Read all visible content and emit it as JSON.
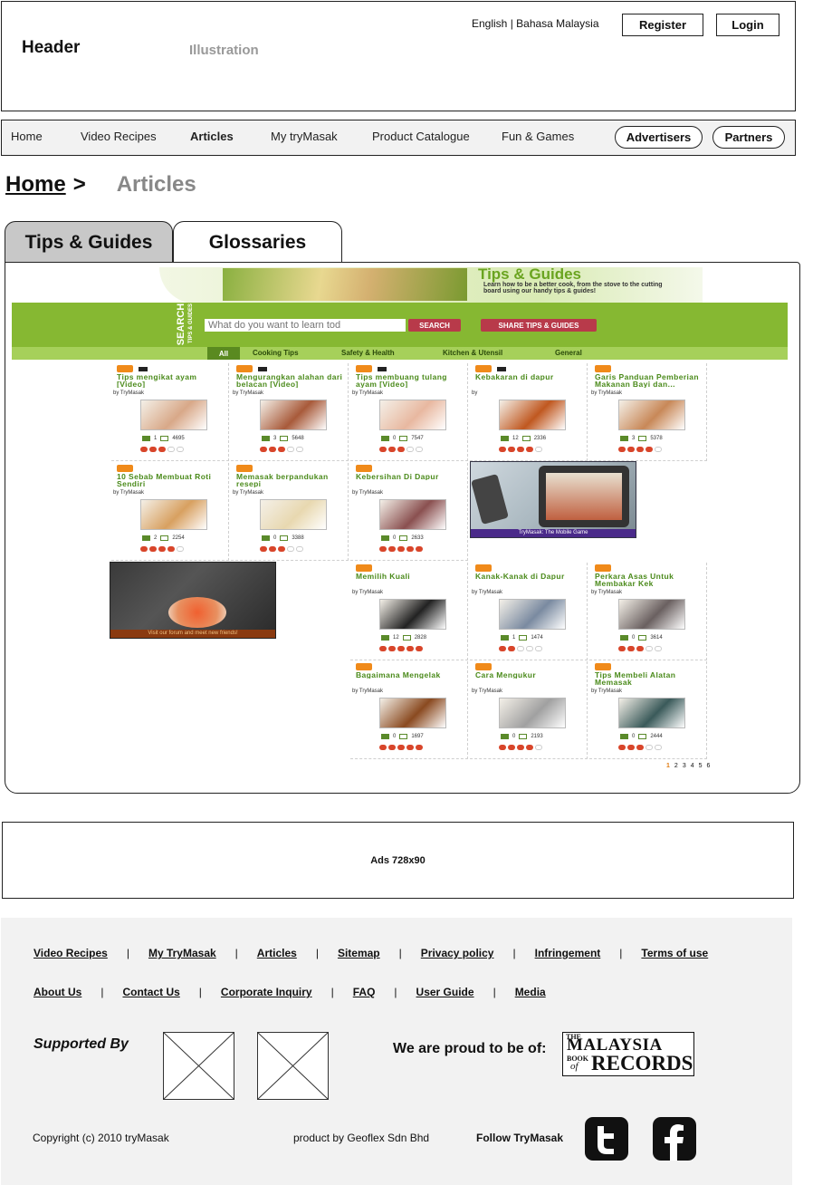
{
  "header": {
    "title": "Header",
    "illustration": "Illustration",
    "lang": "English | Bahasa Malaysia",
    "register": "Register",
    "login": "Login"
  },
  "nav": {
    "items": [
      "Home",
      "Video Recipes",
      "Articles",
      "My tryMasak",
      "Product Catalogue",
      "Fun & Games"
    ],
    "active": "Articles",
    "advertisers": "Advertisers",
    "partners": "Partners"
  },
  "breadcrumb": {
    "home": "Home",
    "sep": ">",
    "current": "Articles"
  },
  "tabs": {
    "tips": "Tips & Guides",
    "glossaries": "Glossaries"
  },
  "banner": {
    "title": "Tips & Guides",
    "subtitle": "Learn how to be a better cook, from the stove to the cutting board using our handy tips & guides!",
    "search_label": "SEARCH",
    "search_sub": "TIPS & GUIDES",
    "search_placeholder": "What do you want to learn tod",
    "search_btn": "SEARCH",
    "share_btn": "SHARE TIPS & GUIDES",
    "categories": [
      "All",
      "Cooking Tips",
      "Safety & Health",
      "Kitchen & Utensil",
      "General"
    ]
  },
  "cards": [
    {
      "title": "Tips mengikat ayam [Video]",
      "by": "by TryMasak",
      "c1": "1",
      "c2": "4695",
      "rating": 3,
      "thumb": "#d8a888"
    },
    {
      "title": "Mengurangkan alahan dari belacan [Video]",
      "by": "by TryMasak",
      "c1": "3",
      "c2": "5648",
      "rating": 3,
      "thumb": "#a85a3a"
    },
    {
      "title": "Tips membuang tulang ayam [Video]",
      "by": "by TryMasak",
      "c1": "0",
      "c2": "7547",
      "rating": 3,
      "thumb": "#e8b8a0"
    },
    {
      "title": "Kebakaran di dapur",
      "by": "by",
      "c1": "12",
      "c2": "2336",
      "rating": 4,
      "thumb": "#c05820"
    },
    {
      "title": "Garis Panduan Pemberian Makanan Bayi dan...",
      "by": "by TryMasak",
      "c1": "3",
      "c2": "5378",
      "rating": 4,
      "thumb": "#c88858"
    },
    {
      "title": "10 Sebab Membuat Roti Sendiri",
      "by": "by TryMasak",
      "c1": "2",
      "c2": "2254",
      "rating": 4,
      "thumb": "#d8a060"
    },
    {
      "title": "Memasak berpandukan resepi",
      "by": "by TryMasak",
      "c1": "0",
      "c2": "3388",
      "rating": 3,
      "thumb": "#e8d8b0"
    },
    {
      "title": "Kebersihan Di Dapur",
      "by": "by TryMasak",
      "c1": "0",
      "c2": "2633",
      "rating": 5,
      "thumb": "#8a5050"
    },
    {
      "title": "Memilih Kuali",
      "by": "by TryMasak",
      "c1": "12",
      "c2": "2828",
      "rating": 5,
      "thumb": "#222222"
    },
    {
      "title": "Kanak-Kanak di Dapur",
      "by": "by TryMasak",
      "c1": "1",
      "c2": "1474",
      "rating": 2,
      "thumb": "#7a8aa0"
    },
    {
      "title": "Perkara Asas Untuk Membakar Kek",
      "by": "by TryMasak",
      "c1": "0",
      "c2": "3614",
      "rating": 3,
      "thumb": "#6a6060"
    },
    {
      "title": "Bagaimana Mengelak",
      "by": "by TryMasak",
      "c1": "0",
      "c2": "1697",
      "rating": 5,
      "thumb": "#8a4a20"
    },
    {
      "title": "Cara Mengukur",
      "by": "by TryMasak",
      "c1": "0",
      "c2": "2193",
      "rating": 4,
      "thumb": "#a0a0a0"
    },
    {
      "title": "Tips Membeli Alatan Memasak",
      "by": "by TryMasak",
      "c1": "0",
      "c2": "2444",
      "rating": 3,
      "thumb": "#3a5a5a"
    }
  ],
  "promo_game": "TryMasak: The Mobile Game",
  "promo_forum": "Visit our forum and meet new friends!",
  "pagination": [
    "1",
    "2",
    "3",
    "4",
    "5",
    "6"
  ],
  "ads": "Ads 728x90",
  "footer": {
    "row1": [
      "Video Recipes",
      "My TryMasak",
      "Articles",
      "Sitemap",
      "Privacy policy",
      "Infringement",
      "Terms of use"
    ],
    "row2": [
      "About Us",
      "Contact Us",
      "Corporate Inquiry",
      "FAQ",
      "User Guide",
      "Media"
    ],
    "supported": "Supported By",
    "proud": "We are proud to be of:",
    "record_top": "THE",
    "record_main": "MALAYSIA",
    "record_book": "BOOK",
    "record_of": "of",
    "record_records": "RECORDS",
    "copyright": "Copyright (c) 2010 tryMasak",
    "product": "product by Geoflex Sdn Bhd",
    "follow": "Follow TryMasak"
  }
}
